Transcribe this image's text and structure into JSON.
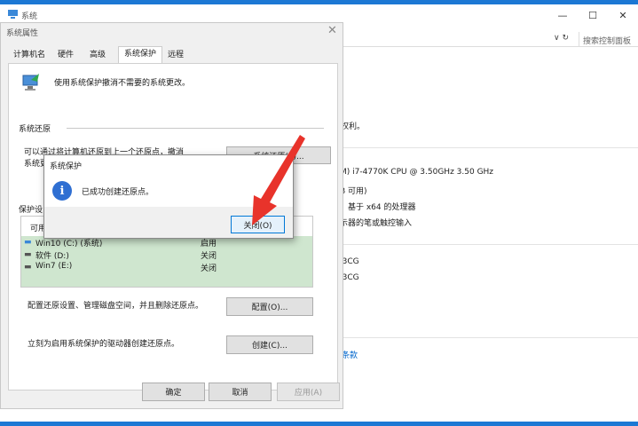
{
  "system_window": {
    "title": "系统",
    "controls": [
      "—",
      "☐",
      "✕"
    ],
    "address_controls": "∨ ↻",
    "search_placeholder": "搜索控制面板",
    "right_texts": [
      "权利。",
      "M) i7-4770K CPU @ 3.50GHz   3.50 GHz",
      "B 可用)",
      "，基于 x64 的处理器",
      "示器的笔或触控输入",
      "J3CG",
      "J3CG"
    ],
    "link_text": "条款"
  },
  "properties_dialog": {
    "title": "系统属性",
    "close": "✕",
    "tabs": [
      "计算机名",
      "硬件",
      "高级",
      "系统保护",
      "远程"
    ],
    "active_tab": "系统保护",
    "intro": "使用系统保护撤消不需要的系统更改。",
    "restore_section_label": "系统还原",
    "restore_desc_line1": "可以通过将计算机还原到上一个还原点，撤消",
    "restore_desc_line2": "系统更",
    "restore_button": "系统还原(S)...",
    "protection_section_label": "保护设",
    "drive_list_header": "可用",
    "drives": [
      {
        "name": "Win10 (C:) (系统)",
        "status": "启用"
      },
      {
        "name": "软件 (D:)",
        "status": "关闭"
      },
      {
        "name": "Win7 (E:)",
        "status": "关闭"
      }
    ],
    "configure_desc": "配置还原设置、管理磁盘空间，并且删除还原点。",
    "configure_button": "配置(O)...",
    "create_desc": "立刻为启用系统保护的驱动器创建还原点。",
    "create_button": "创建(C)...",
    "ok_button": "确定",
    "cancel_button": "取消",
    "apply_button": "应用(A)"
  },
  "message_box": {
    "title": "系统保护",
    "icon": "info-icon",
    "icon_glyph": "i",
    "message": "已成功创建还原点。",
    "close_button": "关闭(O)"
  },
  "colors": {
    "desktop_blue": "#1c78d4",
    "drive_selected": "#cfe6cf",
    "annotation_arrow": "#e8332b"
  }
}
